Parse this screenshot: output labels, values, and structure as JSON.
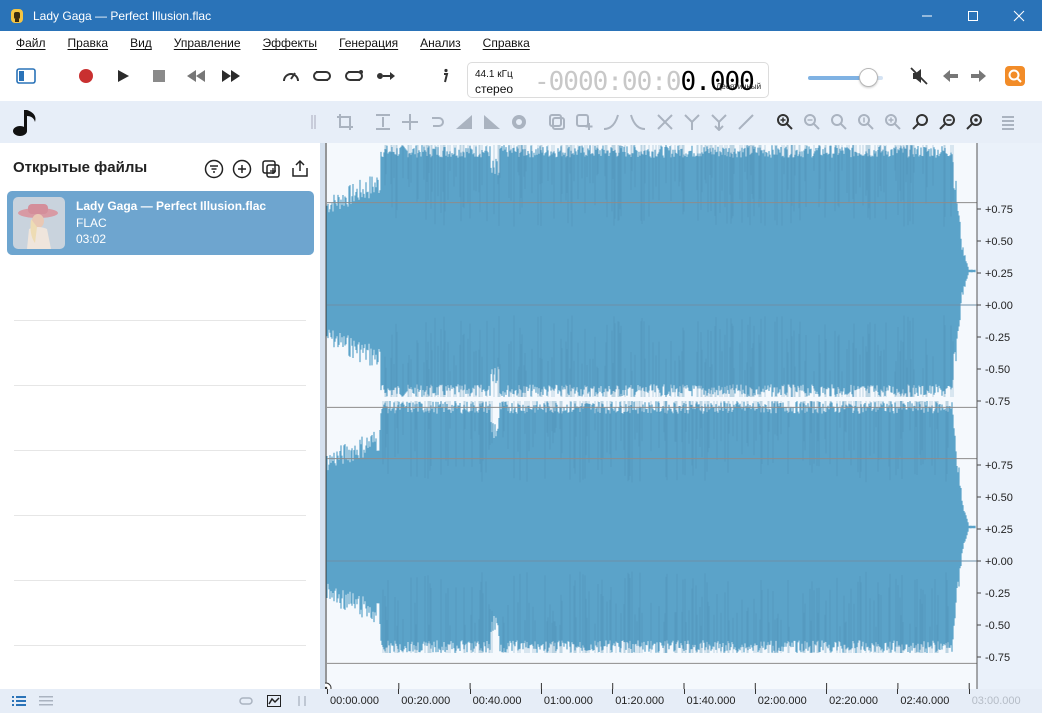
{
  "window": {
    "title": "Lady Gaga — Perfect Illusion.flac"
  },
  "menu": [
    "Файл",
    "Правка",
    "Вид",
    "Управление",
    "Эффекты",
    "Генерация",
    "Анализ",
    "Справка"
  ],
  "display": {
    "sample_rate": "44.1 кГц",
    "channels": "стерео",
    "time_dim": "-0000:00:0",
    "time_bright": "0.000",
    "time_format": "Десятичный"
  },
  "volume_level": 0.8,
  "sidebar": {
    "title": "Открытые файлы",
    "files": [
      {
        "name": "Lady Gaga — Perfect Illusion.flac",
        "format": "FLAC",
        "duration": "03:02"
      }
    ]
  },
  "amplitude_axis": {
    "labels": [
      "+0.75",
      "+0.50",
      "+0.25",
      "+0.00",
      "-0.25",
      "-0.50",
      "-0.75"
    ]
  },
  "time_axis": {
    "labels": [
      "00:00.000",
      "00:20.000",
      "00:40.000",
      "01:00.000",
      "01:20.000",
      "01:40.000",
      "02:00.000",
      "02:20.000",
      "02:40.000",
      "03:00.000"
    ]
  },
  "colors": {
    "titlebar": "#2a73b8",
    "waveform": "#5ba3c9",
    "accent": "#f28c28",
    "record": "#c93030"
  }
}
